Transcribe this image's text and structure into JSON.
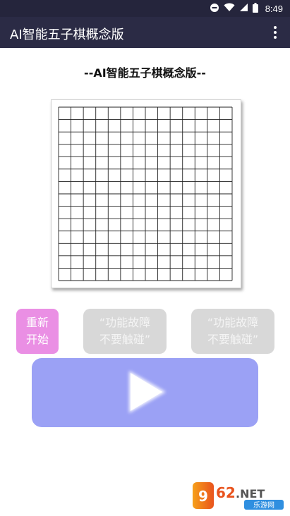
{
  "status_bar": {
    "time": "8:49",
    "icons": [
      "dnd-icon",
      "wifi-icon",
      "signal-icon",
      "battery-icon"
    ]
  },
  "app_bar": {
    "title": "AI智能五子棋概念版",
    "menu_icon": "more-vert-icon"
  },
  "heading": "--AI智能五子棋概念版--",
  "board": {
    "lines": 15,
    "stones": []
  },
  "buttons": {
    "restart_line1": "重新",
    "restart_line2": "开始",
    "fault1_line1": "“功能故障",
    "fault1_line2": "不要触碰”",
    "fault2_line1": "“功能故障",
    "fault2_line2": "不要触碰”"
  },
  "colors": {
    "app_bar": "#2b2b45",
    "restart": "#ea8fe4",
    "disabled": "#d8d8d8",
    "play_panel": "#9ba1f5"
  },
  "watermark": {
    "brand": "962.NET",
    "sub": "乐游网"
  }
}
